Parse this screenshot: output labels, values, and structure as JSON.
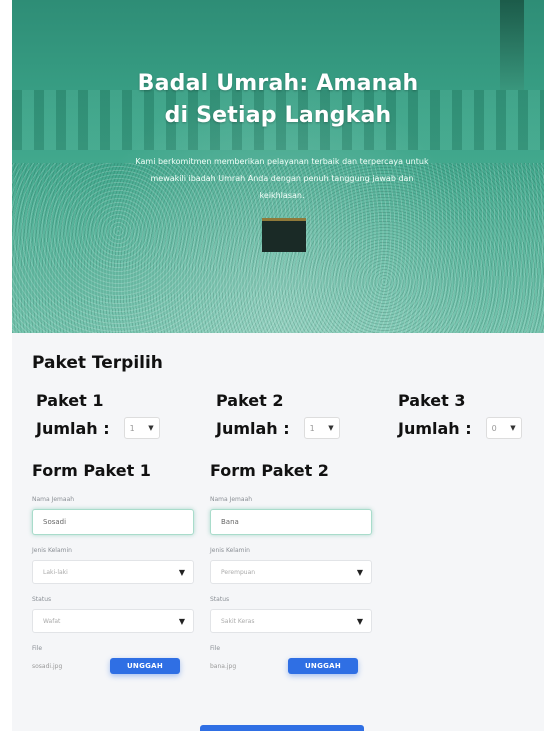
{
  "hero": {
    "title_line1": "Badal Umrah: Amanah",
    "title_line2": "di Setiap Langkah",
    "subtitle": "Kami berkomitmen memberikan pelayanan terbaik dan terpercaya untuk mewakili ibadah Umrah Anda dengan penuh tanggung jawab dan keikhlasan."
  },
  "paket_section": {
    "title": "Paket Terpilih",
    "packages": [
      {
        "name": "Paket 1",
        "jumlah_label": "Jumlah :",
        "value": "1"
      },
      {
        "name": "Paket 2",
        "jumlah_label": "Jumlah :",
        "value": "1"
      },
      {
        "name": "Paket 3",
        "jumlah_label": "Jumlah :",
        "value": "0"
      }
    ]
  },
  "forms": [
    {
      "title": "Form Paket 1",
      "nama_label": "Nama Jemaah",
      "nama_value": "Sosadi",
      "gender_label": "Jenis Kelamin",
      "gender_value": "Laki-laki",
      "status_label": "Status",
      "status_value": "Wafat",
      "file_label": "File",
      "file_name": "sosadi.jpg",
      "upload_label": "UNGGAH"
    },
    {
      "title": "Form Paket 2",
      "nama_label": "Nama Jemaah",
      "nama_value": "Bana",
      "gender_label": "Jenis Kelamin",
      "gender_value": "Perempuan",
      "status_label": "Status",
      "status_value": "Sakit Keras",
      "file_label": "File",
      "file_name": "bana.jpg",
      "upload_label": "UNGGAH"
    }
  ],
  "colors": {
    "hero_overlay": "#3aa287",
    "accent_blue": "#2f6fe4",
    "input_focus": "#a9dccb",
    "section_bg": "#f5f6f8"
  }
}
